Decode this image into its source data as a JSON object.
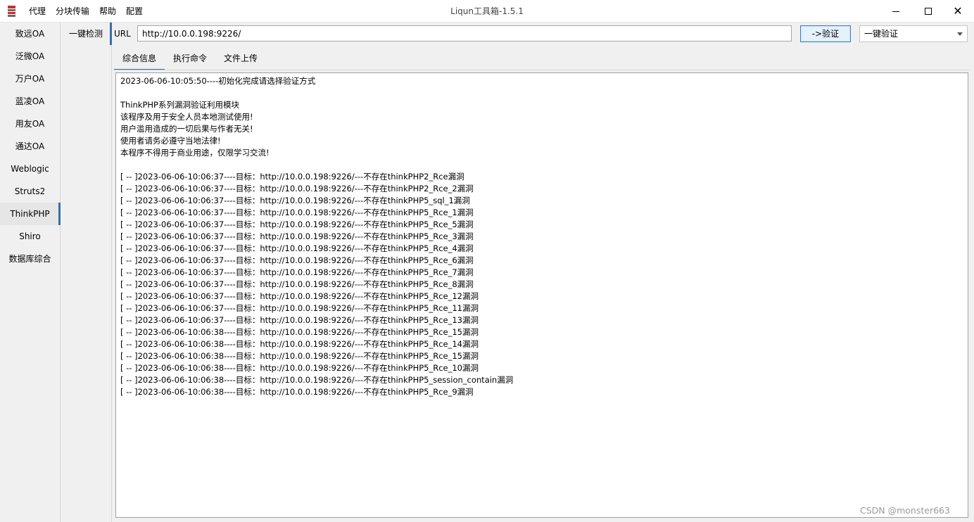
{
  "window": {
    "title": "Liqun工具箱-1.5.1"
  },
  "menu": [
    "代理",
    "分块传输",
    "帮助",
    "配置"
  ],
  "nav": {
    "items": [
      "致远OA",
      "泛微OA",
      "万户OA",
      "蓝凌OA",
      "用友OA",
      "通达OA",
      "Weblogic",
      "Struts2",
      "ThinkPHP",
      "Shiro",
      "数据库综合"
    ],
    "active": "ThinkPHP"
  },
  "subnav": {
    "items": [
      "一键检测"
    ]
  },
  "url": {
    "label": "URL",
    "value": "http://10.0.0.198:9226/"
  },
  "verify_button": "->验证",
  "mode_select": {
    "value": "一键验证"
  },
  "tabs": [
    "综合信息",
    "执行命令",
    "文件上传"
  ],
  "log": [
    "2023-06-06-10:05:50----初始化完成请选择验证方式",
    "",
    "ThinkPHP系列漏洞验证利用模块",
    "该程序及用于安全人员本地测试使用!",
    "用户滥用造成的一切后果与作者无关!",
    "使用者请务必遵守当地法律!",
    "本程序不得用于商业用途，仅限学习交流!",
    "",
    "[ -- ]2023-06-06-10:06:37----目标：http://10.0.0.198:9226/---不存在thinkPHP2_Rce漏洞",
    "[ -- ]2023-06-06-10:06:37----目标：http://10.0.0.198:9226/---不存在thinkPHP2_Rce_2漏洞",
    "[ -- ]2023-06-06-10:06:37----目标：http://10.0.0.198:9226/---不存在thinkPHP5_sql_1漏洞",
    "[ -- ]2023-06-06-10:06:37----目标：http://10.0.0.198:9226/---不存在thinkPHP5_Rce_1漏洞",
    "[ -- ]2023-06-06-10:06:37----目标：http://10.0.0.198:9226/---不存在thinkPHP5_Rce_5漏洞",
    "[ -- ]2023-06-06-10:06:37----目标：http://10.0.0.198:9226/---不存在thinkPHP5_Rce_3漏洞",
    "[ -- ]2023-06-06-10:06:37----目标：http://10.0.0.198:9226/---不存在thinkPHP5_Rce_4漏洞",
    "[ -- ]2023-06-06-10:06:37----目标：http://10.0.0.198:9226/---不存在thinkPHP5_Rce_6漏洞",
    "[ -- ]2023-06-06-10:06:37----目标：http://10.0.0.198:9226/---不存在thinkPHP5_Rce_7漏洞",
    "[ -- ]2023-06-06-10:06:37----目标：http://10.0.0.198:9226/---不存在thinkPHP5_Rce_8漏洞",
    "[ -- ]2023-06-06-10:06:37----目标：http://10.0.0.198:9226/---不存在thinkPHP5_Rce_12漏洞",
    "[ -- ]2023-06-06-10:06:37----目标：http://10.0.0.198:9226/---不存在thinkPHP5_Rce_11漏洞",
    "[ -- ]2023-06-06-10:06:37----目标：http://10.0.0.198:9226/---不存在thinkPHP5_Rce_13漏洞",
    "[ -- ]2023-06-06-10:06:38----目标：http://10.0.0.198:9226/---不存在thinkPHP5_Rce_15漏洞",
    "[ -- ]2023-06-06-10:06:38----目标：http://10.0.0.198:9226/---不存在thinkPHP5_Rce_14漏洞",
    "[ -- ]2023-06-06-10:06:38----目标：http://10.0.0.198:9226/---不存在thinkPHP5_Rce_15漏洞",
    "[ -- ]2023-06-06-10:06:38----目标：http://10.0.0.198:9226/---不存在thinkPHP5_Rce_10漏洞",
    "[ -- ]2023-06-06-10:06:38----目标：http://10.0.0.198:9226/---不存在thinkPHP5_session_contain漏洞",
    "[ -- ]2023-06-06-10:06:38----目标：http://10.0.0.198:9226/---不存在thinkPHP5_Rce_9漏洞"
  ],
  "watermark": "CSDN @monster663"
}
